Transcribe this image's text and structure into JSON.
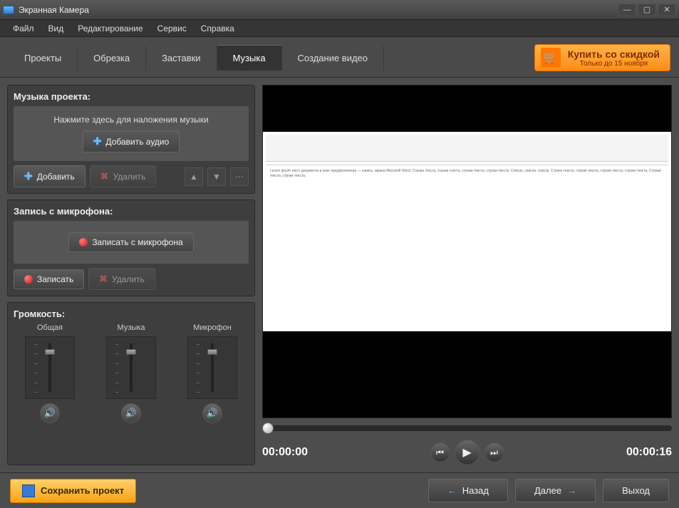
{
  "window": {
    "title": "Экранная Камера"
  },
  "menu": {
    "file": "Файл",
    "view": "Вид",
    "edit": "Редактирование",
    "service": "Сервис",
    "help": "Справка"
  },
  "tabs": {
    "projects": "Проекты",
    "trim": "Обрезка",
    "titles": "Заставки",
    "music": "Музыка",
    "create": "Создание видео"
  },
  "promo": {
    "title": "Купить со скидкой",
    "sub": "Только до 15 ноября"
  },
  "left": {
    "music_panel_title": "Музыка проекта:",
    "hint": "Нажмите здесь для наложения музыки",
    "add_audio": "Добавить аудио",
    "add": "Добавить",
    "delete": "Удалить",
    "mic_panel_title": "Запись с микрофона:",
    "record_mic": "Записать с микрофона",
    "record": "Записать",
    "volume_title": "Громкость:",
    "vol_general": "Общая",
    "vol_music": "Музыка",
    "vol_mic": "Микрофон"
  },
  "playback": {
    "current": "00:00:00",
    "total": "00:00:16"
  },
  "bottom": {
    "save": "Сохранить проект",
    "back": "Назад",
    "next": "Далее",
    "exit": "Выход"
  }
}
